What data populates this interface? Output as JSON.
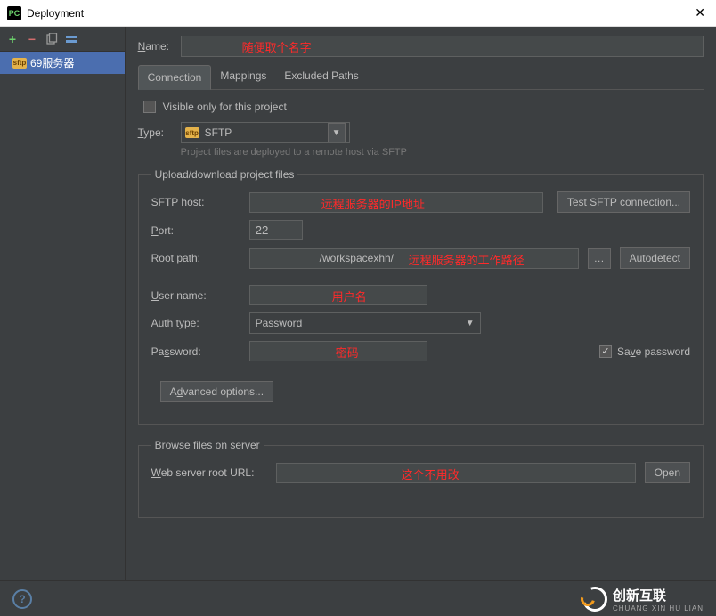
{
  "titlebar": {
    "app": "PC",
    "title": "Deployment"
  },
  "left": {
    "item_label": "69服务器",
    "sftp_badge": "sftp"
  },
  "name_label": "Name:",
  "tabs": [
    {
      "label": "Connection",
      "active": true
    },
    {
      "label": "Mappings",
      "active": false
    },
    {
      "label": "Excluded Paths",
      "active": false
    }
  ],
  "visible_label": "Visible only for this project",
  "type_label": "Type:",
  "type_value": "SFTP",
  "type_badge": "sftp",
  "type_hint": "Project files are deployed to a remote host via SFTP",
  "upload_group": {
    "legend": "Upload/download project files",
    "sftp_host_label": "SFTP host:",
    "test_btn": "Test SFTP connection...",
    "port_label": "Port:",
    "port_value": "22",
    "root_label": "Root path:",
    "root_value": "/workspacexhh/",
    "autodetect_btn": "Autodetect",
    "user_label": "User name:",
    "auth_label": "Auth type:",
    "auth_value": "Password",
    "pass_label": "Password:",
    "save_pass_label": "Save password",
    "adv_btn": "Advanced options..."
  },
  "browse_group": {
    "legend": "Browse files on server",
    "web_label": "Web server root URL:",
    "open_btn": "Open"
  },
  "annotations": {
    "name": "随便取个名字",
    "host": "远程服务器的IP地址",
    "root": "远程服务器的工作路径",
    "user": "用户名",
    "pass": "密码",
    "web": "这个不用改"
  },
  "brand": {
    "text": "创新互联",
    "sub": "CHUANG XIN HU LIAN"
  }
}
